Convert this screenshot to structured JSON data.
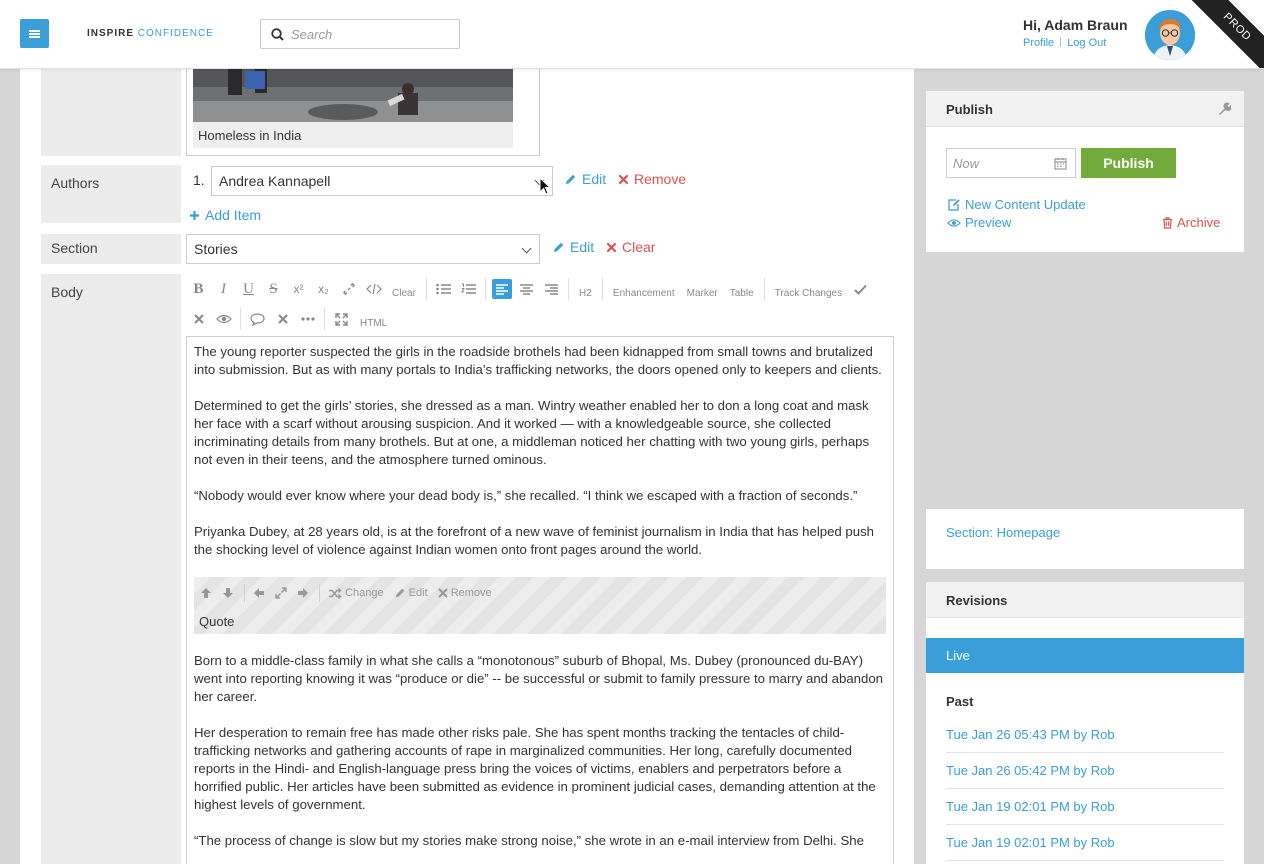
{
  "header": {
    "brand_part1": "INSPIRE",
    "brand_part2": "CONFIDENCE",
    "search_placeholder": "Search",
    "greeting": "Hi, Adam Braun",
    "profile_link": "Profile",
    "logout_link": "Log Out",
    "env_ribbon": "PROD"
  },
  "lead_image": {
    "caption": "Homeless in India"
  },
  "authors": {
    "label": "Authors",
    "items": [
      {
        "index": "1.",
        "name": "Andrea Kannapell"
      }
    ],
    "edit_label": "Edit",
    "remove_label": "Remove",
    "add_item_label": "Add Item"
  },
  "section": {
    "label": "Section",
    "value": "Stories",
    "edit_label": "Edit",
    "clear_label": "Clear"
  },
  "body": {
    "label": "Body",
    "toolbar_text": {
      "clear": "Clear",
      "h2": "H2",
      "enhancement": "Enhancement",
      "marker": "Marker",
      "table": "Table",
      "track_changes": "Track Changes",
      "html": "HTML"
    },
    "paragraphs": [
      "The young reporter suspected the girls in the roadside brothels had been kidnapped from small towns and brutalized into submission. But as with many portals to India’s trafficking networks, the doors opened only to keepers and clients.",
      "Determined to get the girls’ stories, she dressed as a man. Wintry weather enabled her to don a long coat and mask her face with a scarf without arousing suspicion. And it worked — with a knowledgeable source, she collected incriminating details from many brothels. But at one, a middleman noticed her chatting with two young girls, perhaps not even in their teens, and the atmosphere turned ominous.",
      "“Nobody would ever know where your dead body is,” she recalled. “I think we escaped with a fraction of seconds.”",
      "Priyanka Dubey, at 28 years old, is at the forefront of a new wave of feminist journalism in India that has helped push the shocking level of violence against Indian women onto front pages around the world."
    ],
    "embed": {
      "change_label": "Change",
      "edit_label": "Edit",
      "remove_label": "Remove",
      "type_label": "Quote"
    },
    "paragraphs_after": [
      "Born to a middle-class family in what she calls a “monotonous” suburb of Bhopal, Ms. Dubey (pronounced du-BAY) went into reporting knowing it was “produce or die” -- be successful or submit to family pressure to marry and abandon her career.",
      "Her desperation to remain free has made other risks pale. She has spent months tracking the tentacles of child-trafficking networks and gathering accounts of rape in marginalized communities. Her long, carefully documented reports in the Hindi- and English-language press bring the voices of victims, enablers and perpetrators before a horrified public. Her articles have been submitted as evidence in prominent judicial cases, demanding attention at the highest levels of government.",
      "“The process of change is slow but my stories make strong noise,” she wrote in an e-mail interview from Delhi. She"
    ]
  },
  "publish_panel": {
    "title": "Publish",
    "date_placeholder": "Now",
    "publish_button": "Publish",
    "new_content_update": "New Content Update",
    "preview": "Preview",
    "archive": "Archive"
  },
  "section_panel": {
    "link": "Section: Homepage"
  },
  "revisions_panel": {
    "title": "Revisions",
    "live_label": "Live",
    "past_label": "Past",
    "items": [
      "Tue Jan 26 05:43 PM by Rob",
      "Tue Jan 26 05:42 PM by Rob",
      "Tue Jan 19 02:01 PM by Rob",
      "Tue Jan 19 02:01 PM by Rob"
    ]
  },
  "colors": {
    "accent": "#3a9ed9",
    "danger": "#d9534f",
    "publish": "#72ab3c"
  }
}
